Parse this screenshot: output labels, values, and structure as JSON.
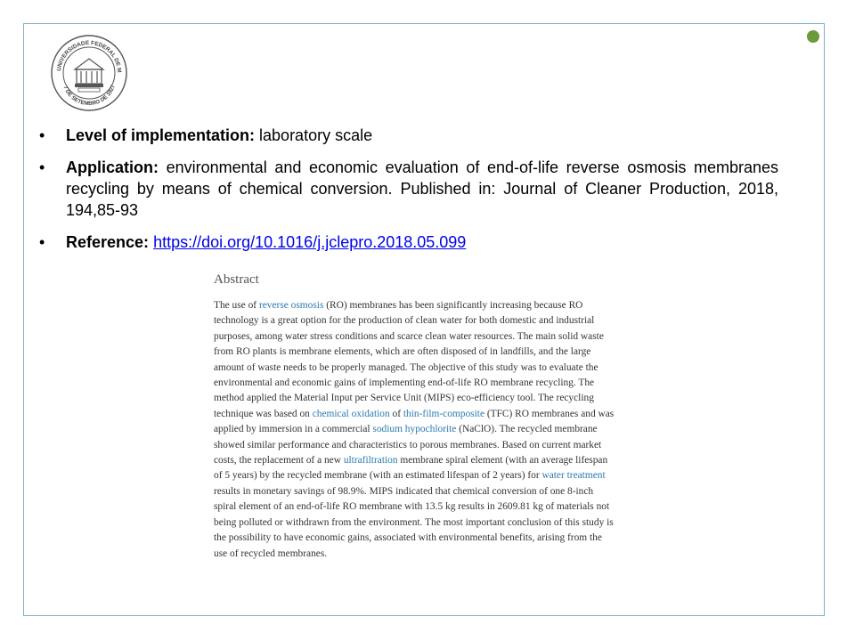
{
  "logo": {
    "ring_text": "UNIVERSIDADE FEDERAL DE MINAS GERAIS",
    "bottom_text": "7 DE SETEMBRO DE 1927"
  },
  "bullets": [
    {
      "label": "Level of implementation:",
      "text": " laboratory scale"
    },
    {
      "label": "Application:",
      "text": " environmental and economic evaluation of end-of-life reverse osmosis membranes  recycling by means of chemical conversion. Published in: Journal of Cleaner Production, 2018, 194,85-93"
    },
    {
      "label": "Reference:",
      "link": "https://doi.org/10.1016/j.jclepro.2018.05.099"
    }
  ],
  "abstract": {
    "heading": "Abstract",
    "segments": [
      {
        "t": "The use of "
      },
      {
        "t": "reverse osmosis",
        "kw": true
      },
      {
        "t": " (RO) membranes has been significantly increasing because RO technology is a great option for the production of clean water for both domestic and industrial purposes, among water stress conditions and scarce clean water resources. The main solid waste from RO plants is membrane elements, which are often disposed of in landfills, and the large amount of waste needs to be properly managed. The objective of this study was to evaluate the environmental and economic gains of implementing end-of-life RO membrane recycling. The method applied the Material Input per Service Unit (MIPS) eco-efficiency tool. The recycling technique was based on "
      },
      {
        "t": "chemical oxidation",
        "kw": true
      },
      {
        "t": " of "
      },
      {
        "t": "thin-film-composite",
        "kw": true
      },
      {
        "t": " (TFC) RO membranes and was applied by immersion in a commercial "
      },
      {
        "t": "sodium hypochlorite",
        "kw": true
      },
      {
        "t": " (NaClO). The recycled membrane showed similar performance and characteristics to porous membranes. Based on current market costs, the replacement of a new "
      },
      {
        "t": "ultrafiltration",
        "kw": true
      },
      {
        "t": " membrane spiral element (with an average lifespan of 5 years) by the recycled membrane (with an estimated lifespan of 2 years) for "
      },
      {
        "t": "water treatment",
        "kw": true
      },
      {
        "t": " results in monetary savings of 98.9%. MIPS indicated that chemical conversion of one 8-inch spiral element of an end-of-life RO membrane with 13.5 kg results in 2609.81 kg of materials not being polluted or withdrawn from the environment. The most important conclusion of this study is the possibility to have economic gains, associated with environmental benefits, arising from the use of recycled membranes."
      }
    ]
  },
  "colors": {
    "frame": "#7fb3c8",
    "dot": "#6b9a3a",
    "keyword": "#2a7ab0",
    "link": "#0000ee"
  }
}
